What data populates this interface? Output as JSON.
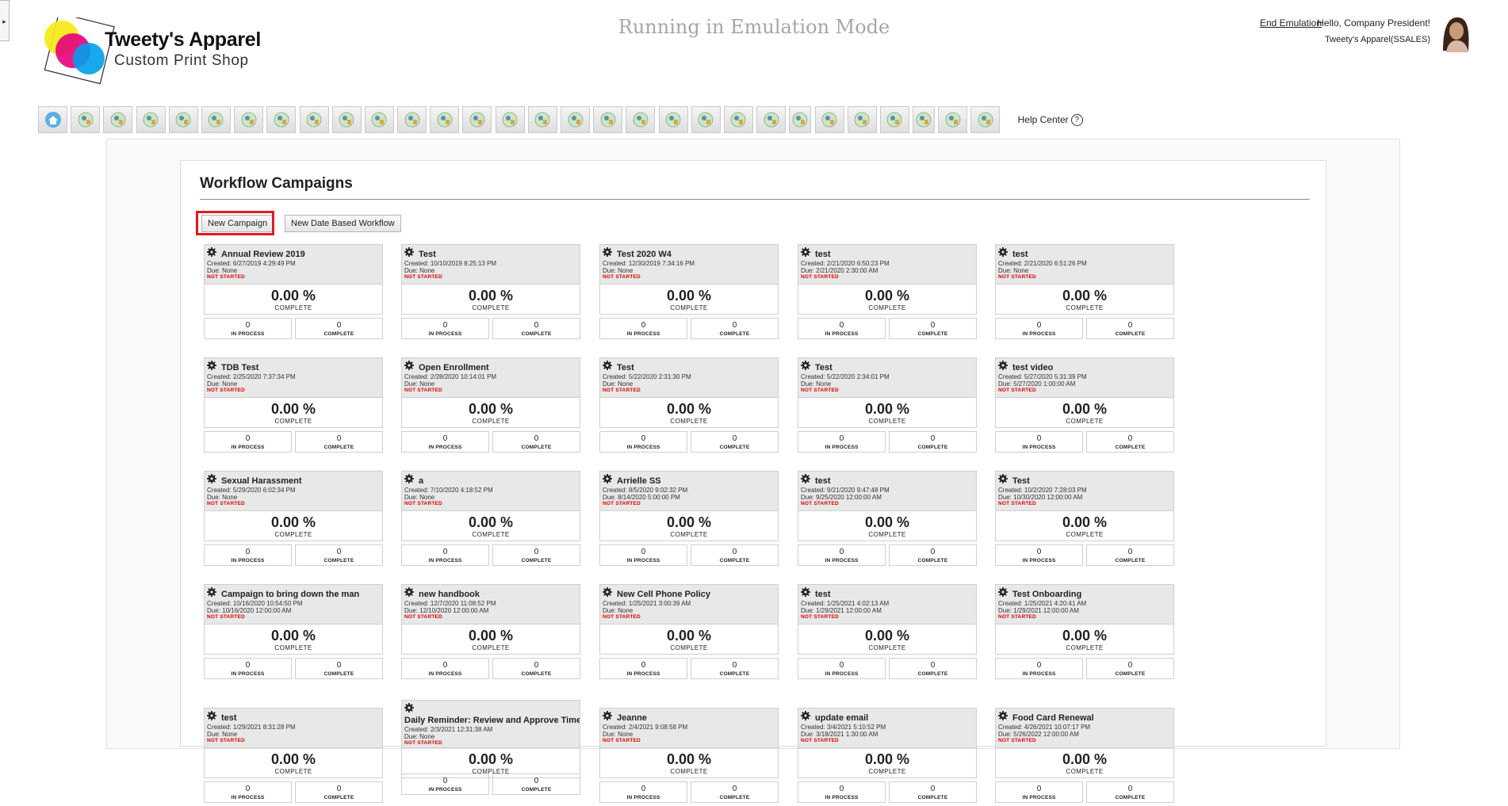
{
  "brand": {
    "name": "Tweety's Apparel",
    "subtitle": "Custom Print Shop"
  },
  "header": {
    "emulation_title": "Running in Emulation Mode",
    "end_emulation": "End Emulation",
    "greeting": "Hello, Company President!",
    "company": "Tweety's Apparel(SSALES)",
    "help_center": "Help Center",
    "help_icon_glyph": "?"
  },
  "side_toggle_glyph": "▸",
  "toolbar": {
    "buttons": [
      {
        "icon": "home-icon"
      },
      {
        "icon": "wheel-icon"
      },
      {
        "icon": "gear-icon"
      },
      {
        "icon": "presentation-icon"
      },
      {
        "icon": "people-icon"
      },
      {
        "icon": "org-chart-icon"
      },
      {
        "icon": "edit-document-icon"
      },
      {
        "icon": "money-bag-icon"
      },
      {
        "icon": "search-person-icon"
      },
      {
        "icon": "target-icon"
      },
      {
        "icon": "target-icon"
      },
      {
        "icon": "bar-chart-icon"
      },
      {
        "icon": "target-icon"
      },
      {
        "icon": "person-arrows-icon"
      },
      {
        "icon": "person-flag-icon"
      },
      {
        "icon": "shield-icon"
      },
      {
        "icon": "award-person-icon"
      },
      {
        "icon": "person-tools-icon"
      },
      {
        "icon": "search-remove-icon"
      },
      {
        "icon": "fingerprint-icon"
      },
      {
        "icon": "money-bag-icon"
      },
      {
        "icon": "person-flag-icon"
      },
      {
        "icon": "team-chart-icon"
      },
      {
        "icon": "medical-clipboard-icon"
      },
      {
        "icon": "shield-icon"
      },
      {
        "icon": "id-badge-icon"
      },
      {
        "icon": "gift-icon"
      },
      {
        "icon": "document-icon"
      },
      {
        "icon": "group-icon"
      },
      {
        "icon": "certificate-icon"
      }
    ]
  },
  "page": {
    "title": "Workflow Campaigns",
    "new_campaign": "New Campaign",
    "new_date_workflow": "New Date Based Workflow"
  },
  "colors": {
    "highlight": "#e3191f",
    "status_red": "#e00000",
    "card_head": "#e8e8e8"
  },
  "campaigns": [
    {
      "name": "Annual Review 2019",
      "created": "Created: 6/27/2019 4:29:49 PM",
      "due": "Due: None",
      "status": "NOT STARTED",
      "percent": "0.00 %",
      "percent_label": "COMPLETE",
      "in_process": "0",
      "in_process_label": "IN PROCESS",
      "complete": "0",
      "complete_label": "COMPLETE"
    },
    {
      "name": "Test",
      "created": "Created: 10/10/2019 8:25:13 PM",
      "due": "Due: None",
      "status": "NOT STARTED",
      "percent": "0.00 %",
      "percent_label": "COMPLETE",
      "in_process": "0",
      "in_process_label": "IN PROCESS",
      "complete": "0",
      "complete_label": "COMPLETE"
    },
    {
      "name": "Test 2020 W4",
      "created": "Created: 12/30/2019 7:34:16 PM",
      "due": "Due: None",
      "status": "NOT STARTED",
      "percent": "0.00 %",
      "percent_label": "COMPLETE",
      "in_process": "0",
      "in_process_label": "IN PROCESS",
      "complete": "0",
      "complete_label": "COMPLETE"
    },
    {
      "name": "test",
      "created": "Created: 2/21/2020 6:50:23 PM",
      "due": "Due: 2/21/2020 2:30:00 AM",
      "status": "NOT STARTED",
      "percent": "0.00 %",
      "percent_label": "COMPLETE",
      "in_process": "0",
      "in_process_label": "IN PROCESS",
      "complete": "0",
      "complete_label": "COMPLETE"
    },
    {
      "name": "test",
      "created": "Created: 2/21/2020 6:51:26 PM",
      "due": "Due: None",
      "status": "NOT STARTED",
      "percent": "0.00 %",
      "percent_label": "COMPLETE",
      "in_process": "0",
      "in_process_label": "IN PROCESS",
      "complete": "0",
      "complete_label": "COMPLETE"
    },
    {
      "name": "TDB Test",
      "created": "Created: 2/25/2020 7:37:34 PM",
      "due": "Due: None",
      "status": "NOT STARTED",
      "percent": "0.00 %",
      "percent_label": "COMPLETE",
      "in_process": "0",
      "in_process_label": "IN PROCESS",
      "complete": "0",
      "complete_label": "COMPLETE"
    },
    {
      "name": "Open Enrollment",
      "created": "Created: 2/28/2020 10:14:01 PM",
      "due": "Due: None",
      "status": "NOT STARTED",
      "percent": "0.00 %",
      "percent_label": "COMPLETE",
      "in_process": "0",
      "in_process_label": "IN PROCESS",
      "complete": "0",
      "complete_label": "COMPLETE"
    },
    {
      "name": "Test",
      "created": "Created: 5/22/2020 2:31:30 PM",
      "due": "Due: None",
      "status": "NOT STARTED",
      "percent": "0.00 %",
      "percent_label": "COMPLETE",
      "in_process": "0",
      "in_process_label": "IN PROCESS",
      "complete": "0",
      "complete_label": "COMPLETE"
    },
    {
      "name": "Test",
      "created": "Created: 5/22/2020 2:34:01 PM",
      "due": "Due: None",
      "status": "NOT STARTED",
      "percent": "0.00 %",
      "percent_label": "COMPLETE",
      "in_process": "0",
      "in_process_label": "IN PROCESS",
      "complete": "0",
      "complete_label": "COMPLETE"
    },
    {
      "name": "test video",
      "created": "Created: 5/27/2020 5:31:39 PM",
      "due": "Due: 5/27/2020 1:00:00 AM",
      "status": "NOT STARTED",
      "percent": "0.00 %",
      "percent_label": "COMPLETE",
      "in_process": "0",
      "in_process_label": "IN PROCESS",
      "complete": "0",
      "complete_label": "COMPLETE"
    },
    {
      "name": "Sexual Harassment",
      "created": "Created: 5/29/2020 6:02:34 PM",
      "due": "Due: None",
      "status": "NOT STARTED",
      "percent": "0.00 %",
      "percent_label": "COMPLETE",
      "in_process": "0",
      "in_process_label": "IN PROCESS",
      "complete": "0",
      "complete_label": "COMPLETE"
    },
    {
      "name": "a",
      "created": "Created: 7/10/2020 4:18:52 PM",
      "due": "Due: None",
      "status": "NOT STARTED",
      "percent": "0.00 %",
      "percent_label": "COMPLETE",
      "in_process": "0",
      "in_process_label": "IN PROCESS",
      "complete": "0",
      "complete_label": "COMPLETE"
    },
    {
      "name": "Arrielle SS",
      "created": "Created: 8/5/2020 9:02:32 PM",
      "due": "Due: 8/14/2020 5:00:00 PM",
      "status": "NOT STARTED",
      "percent": "0.00 %",
      "percent_label": "COMPLETE",
      "in_process": "0",
      "in_process_label": "IN PROCESS",
      "complete": "0",
      "complete_label": "COMPLETE"
    },
    {
      "name": "test",
      "created": "Created: 9/21/2020 9:47:48 PM",
      "due": "Due: 9/25/2020 12:00:00 AM",
      "status": "NOT STARTED",
      "percent": "0.00 %",
      "percent_label": "COMPLETE",
      "in_process": "0",
      "in_process_label": "IN PROCESS",
      "complete": "0",
      "complete_label": "COMPLETE"
    },
    {
      "name": "Test",
      "created": "Created: 10/2/2020 7:28:03 PM",
      "due": "Due: 10/30/2020 12:00:00 AM",
      "status": "NOT STARTED",
      "percent": "0.00 %",
      "percent_label": "COMPLETE",
      "in_process": "0",
      "in_process_label": "IN PROCESS",
      "complete": "0",
      "complete_label": "COMPLETE"
    },
    {
      "name": "Campaign to bring down the man",
      "created": "Created: 10/16/2020 10:54:50 PM",
      "due": "Due: 10/16/2020 12:00:00 AM",
      "status": "NOT STARTED",
      "percent": "0.00 %",
      "percent_label": "COMPLETE",
      "in_process": "0",
      "in_process_label": "IN PROCESS",
      "complete": "0",
      "complete_label": "COMPLETE"
    },
    {
      "name": "new handbook",
      "created": "Created: 12/7/2020 11:08:52 PM",
      "due": "Due: 12/10/2020 12:00:00 AM",
      "status": "NOT STARTED",
      "percent": "0.00 %",
      "percent_label": "COMPLETE",
      "in_process": "0",
      "in_process_label": "IN PROCESS",
      "complete": "0",
      "complete_label": "COMPLETE"
    },
    {
      "name": "New Cell Phone Policy",
      "created": "Created: 1/25/2021 3:00:39 AM",
      "due": "Due: None",
      "status": "NOT STARTED",
      "percent": "0.00 %",
      "percent_label": "COMPLETE",
      "in_process": "0",
      "in_process_label": "IN PROCESS",
      "complete": "0",
      "complete_label": "COMPLETE"
    },
    {
      "name": "test",
      "created": "Created: 1/25/2021 4:02:13 AM",
      "due": "Due: 1/29/2021 12:00:00 AM",
      "status": "NOT STARTED",
      "percent": "0.00 %",
      "percent_label": "COMPLETE",
      "in_process": "0",
      "in_process_label": "IN PROCESS",
      "complete": "0",
      "complete_label": "COMPLETE"
    },
    {
      "name": "Test Onboarding",
      "created": "Created: 1/25/2021 4:20:41 AM",
      "due": "Due: 1/29/2021 12:00:00 AM",
      "status": "NOT STARTED",
      "percent": "0.00 %",
      "percent_label": "COMPLETE",
      "in_process": "0",
      "in_process_label": "IN PROCESS",
      "complete": "0",
      "complete_label": "COMPLETE"
    },
    {
      "name": "test",
      "created": "Created: 1/29/2021 8:31:28 PM",
      "due": "Due: None",
      "status": "NOT STARTED",
      "percent": "0.00 %",
      "percent_label": "COMPLETE",
      "in_process": "0",
      "in_process_label": "IN PROCESS",
      "complete": "0",
      "complete_label": "COMPLETE"
    },
    {
      "name": "Daily Reminder: Review and Approve Timecards",
      "created": "Created: 2/3/2021 12:31:38 AM",
      "due": "Due: None",
      "status": "NOT STARTED",
      "percent": "0.00 %",
      "percent_label": "COMPLETE",
      "in_process": "0",
      "in_process_label": "IN PROCESS",
      "complete": "0",
      "complete_label": "COMPLETE"
    },
    {
      "name": "Jeanne",
      "created": "Created: 2/4/2021 9:08:58 PM",
      "due": "Due: None",
      "status": "NOT STARTED",
      "percent": "0.00 %",
      "percent_label": "COMPLETE",
      "in_process": "0",
      "in_process_label": "IN PROCESS",
      "complete": "0",
      "complete_label": "COMPLETE"
    },
    {
      "name": "update email",
      "created": "Created: 3/4/2021 5:10:52 PM",
      "due": "Due: 3/18/2021 1:30:00 AM",
      "status": "NOT STARTED",
      "percent": "0.00 %",
      "percent_label": "COMPLETE",
      "in_process": "0",
      "in_process_label": "IN PROCESS",
      "complete": "0",
      "complete_label": "COMPLETE"
    },
    {
      "name": "Food Card Renewal",
      "created": "Created: 4/26/2021 10:07:17 PM",
      "due": "Due: 5/26/2022 12:00:00 AM",
      "status": "NOT STARTED",
      "percent": "0.00 %",
      "percent_label": "COMPLETE",
      "in_process": "0",
      "in_process_label": "IN PROCESS",
      "complete": "0",
      "complete_label": "COMPLETE"
    }
  ]
}
